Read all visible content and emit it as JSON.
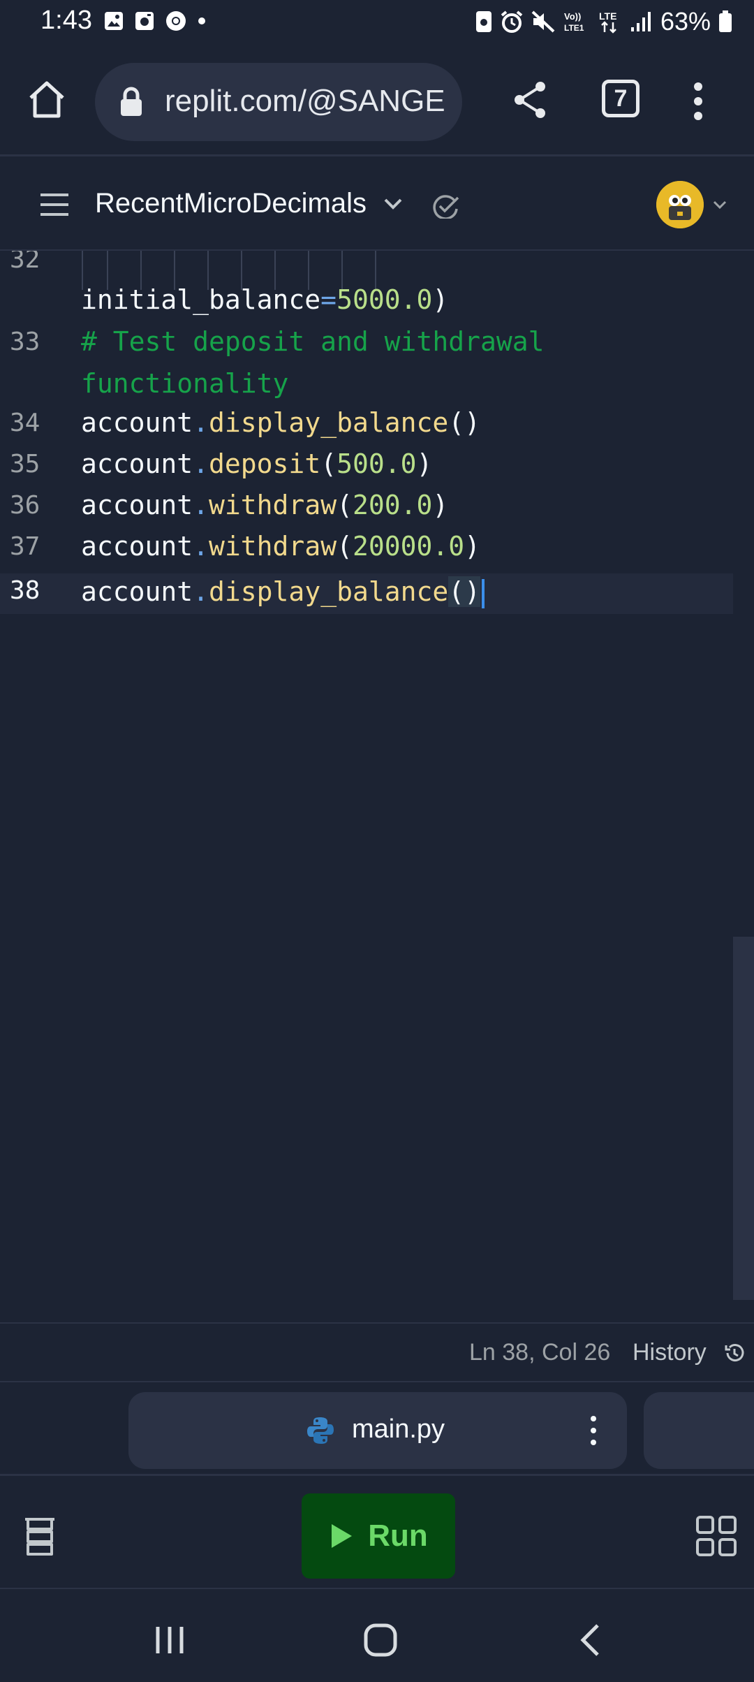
{
  "status_bar": {
    "time": "1:43",
    "battery": "63%"
  },
  "browser": {
    "url": "replit.com/@SANGE",
    "tab_count": "7"
  },
  "repl": {
    "name": "RecentMicroDecimals"
  },
  "editor": {
    "lines": [
      {
        "number": "32",
        "text": "initial_balance=5000.0)"
      },
      {
        "number": "33",
        "text": "# Test deposit and withdrawal functionality"
      },
      {
        "number": "34",
        "text": "account.display_balance()"
      },
      {
        "number": "35",
        "text": "account.deposit(500.0)"
      },
      {
        "number": "36",
        "text": "account.withdraw(200.0)"
      },
      {
        "number": "37",
        "text": "account.withdraw(20000.0)"
      },
      {
        "number": "38",
        "text": "account.display_balance()"
      }
    ],
    "tokens": {
      "l32_name": "initial_balance",
      "l32_eq": "=",
      "l32_num": "5000.0",
      "l32_close": ")",
      "l33_a": "# Test deposit and withdrawal",
      "l33_b": "functionality",
      "obj": "account",
      "dot": ".",
      "fn_display": "display_balance",
      "fn_deposit": "deposit",
      "fn_withdraw": "withdraw",
      "n500": "500.0",
      "n200": "200.0",
      "n20000": "20000.0",
      "open": "(",
      "close": ")"
    }
  },
  "status_line": {
    "cursor_position": "Ln 38, Col 26",
    "history_label": "History"
  },
  "file_tab": {
    "name": "main.py"
  },
  "action_bar": {
    "run_label": "Run"
  },
  "colors": {
    "background": "#1c2333",
    "surface": "#2b3245",
    "run_bg": "#044a10",
    "run_fg": "#6bd968",
    "function": "#f2d98d",
    "number": "#b9df8a",
    "comment": "#16a34a"
  }
}
